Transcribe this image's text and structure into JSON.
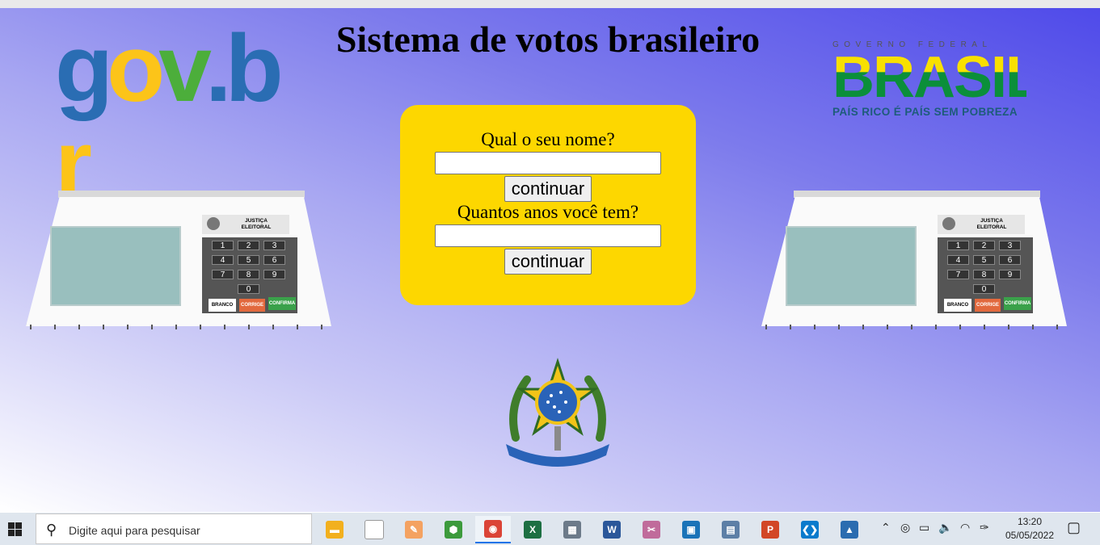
{
  "page": {
    "title": "Sistema de votos brasileiro",
    "govbr_logo": [
      "g",
      "o",
      "v",
      ".",
      "b",
      "r"
    ],
    "brasil_logo": {
      "top": "GOVERNO FEDERAL",
      "word": "BRASIL",
      "bottom": "PAÍS RICO É PAÍS SEM POBREZA"
    },
    "form": {
      "name_question": "Qual o seu nome?",
      "name_value": "",
      "continue_1": "continuar",
      "age_question": "Quantos anos você tem?",
      "age_value": "",
      "continue_2": "continuar"
    },
    "urna": {
      "label": "JUSTIÇA ELEITORAL",
      "keys": [
        "1",
        "2",
        "3",
        "4",
        "5",
        "6",
        "7",
        "8",
        "9",
        "0"
      ],
      "branco": "BRANCO",
      "corrige": "CORRIGE",
      "confirma": "CONFIRMA"
    }
  },
  "taskbar": {
    "search_placeholder": "Digite aqui para pesquisar",
    "apps": [
      {
        "name": "file-explorer-icon",
        "color": "#f2b01e",
        "glyph": "▬"
      },
      {
        "name": "notepad-icon",
        "color": "#ffffff",
        "glyph": ""
      },
      {
        "name": "paint-icon",
        "color": "#f4a261",
        "glyph": "✎"
      },
      {
        "name": "node-icon",
        "color": "#3c9a3c",
        "glyph": "⬢"
      },
      {
        "name": "chrome-icon",
        "color": "#db4437",
        "glyph": "◉"
      },
      {
        "name": "excel-icon",
        "color": "#1d6f42",
        "glyph": "X"
      },
      {
        "name": "calculator-icon",
        "color": "#6c7a89",
        "glyph": "▦"
      },
      {
        "name": "word-icon",
        "color": "#2b579a",
        "glyph": "W"
      },
      {
        "name": "snipping-icon",
        "color": "#c06b9b",
        "glyph": "✂"
      },
      {
        "name": "store-icon",
        "color": "#1a73b8",
        "glyph": "▣"
      },
      {
        "name": "printer-icon",
        "color": "#5d7fa6",
        "glyph": "▤"
      },
      {
        "name": "powerpoint-icon",
        "color": "#d24726",
        "glyph": "P"
      },
      {
        "name": "vscode-icon",
        "color": "#0a7acc",
        "glyph": "❮❯"
      },
      {
        "name": "photos-icon",
        "color": "#2b6cb0",
        "glyph": "▲"
      }
    ],
    "time": "13:20",
    "date": "05/05/2022"
  },
  "colors": {
    "form_bg": "#fdd700",
    "gov_blue": "#2a6db3",
    "gov_yellow": "#fcc419",
    "gov_green": "#4cae3b"
  }
}
